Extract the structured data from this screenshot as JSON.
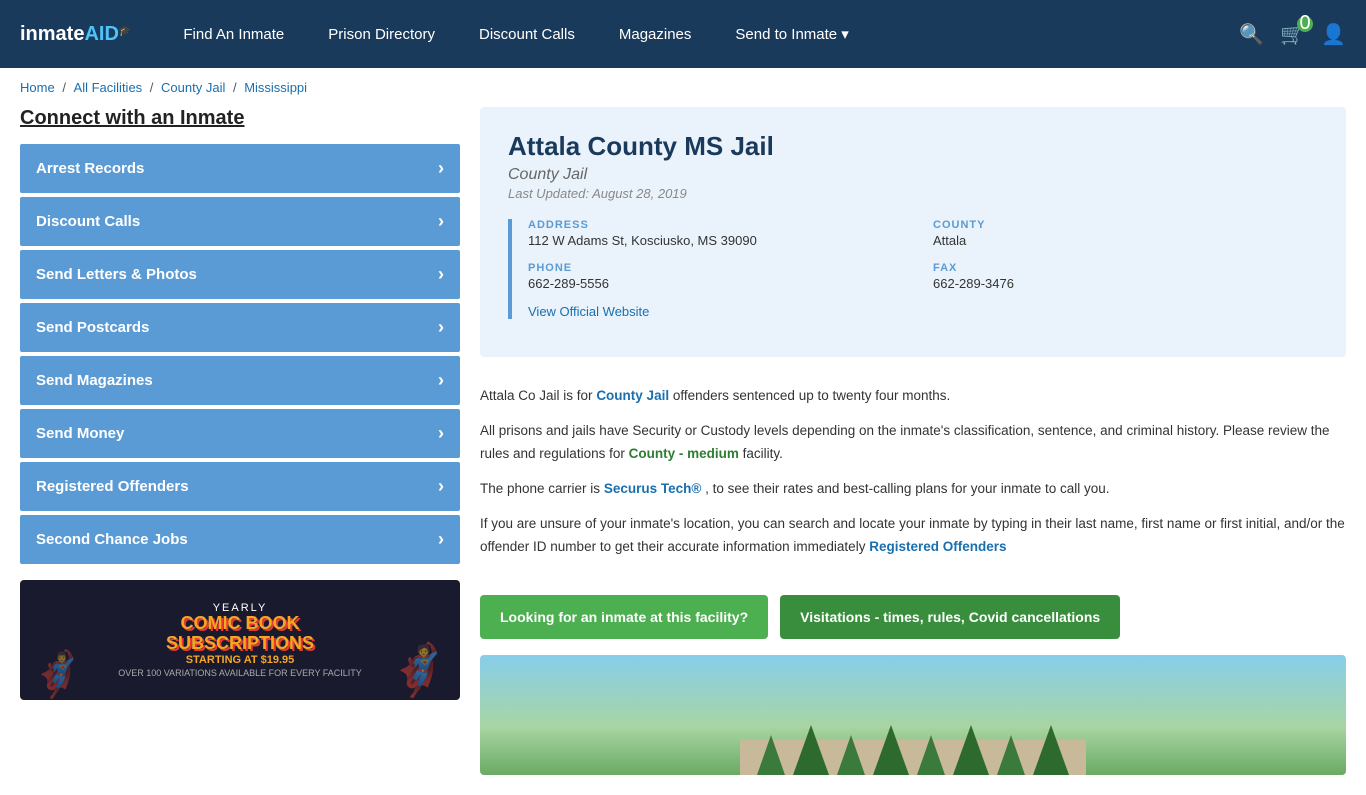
{
  "header": {
    "logo": "inmateAID",
    "logo_icon": "🎓",
    "nav": [
      {
        "label": "Find An Inmate",
        "href": "#"
      },
      {
        "label": "Prison Directory",
        "href": "#"
      },
      {
        "label": "Discount Calls",
        "href": "#"
      },
      {
        "label": "Magazines",
        "href": "#"
      },
      {
        "label": "Send to Inmate ▾",
        "href": "#"
      }
    ],
    "cart_count": "0",
    "search_placeholder": "Search..."
  },
  "breadcrumb": {
    "items": [
      "Home",
      "All Facilities",
      "County Jail",
      "Mississippi"
    ],
    "separators": [
      "/",
      "/",
      "/"
    ]
  },
  "sidebar": {
    "title": "Connect with an Inmate",
    "menu_items": [
      "Arrest Records",
      "Discount Calls",
      "Send Letters & Photos",
      "Send Postcards",
      "Send Magazines",
      "Send Money",
      "Registered Offenders",
      "Second Chance Jobs"
    ],
    "ad": {
      "eyebrow": "YEARLY",
      "title": "COMIC BOOK\nSUBSCRIPTIONS",
      "subtitle": "STARTING AT $19.95",
      "note": "OVER 100 VARIATIONS AVAILABLE FOR EVERY FACILITY"
    }
  },
  "facility": {
    "name": "Attala County MS Jail",
    "type": "County Jail",
    "last_updated": "Last Updated: August 28, 2019",
    "address_label": "ADDRESS",
    "address_value": "112 W Adams St, Kosciusko, MS 39090",
    "county_label": "COUNTY",
    "county_value": "Attala",
    "phone_label": "PHONE",
    "phone_value": "662-289-5556",
    "fax_label": "FAX",
    "fax_value": "662-289-3476",
    "website_label": "View Official Website",
    "website_href": "#",
    "desc1": "Attala Co Jail is for",
    "desc1_link": "County Jail",
    "desc1_end": " offenders sentenced up to twenty four months.",
    "desc2": "All prisons and jails have Security or Custody levels depending on the inmate's classification, sentence, and criminal history. Please review the rules and regulations for",
    "desc2_link": "County - medium",
    "desc2_end": " facility.",
    "desc3": "The phone carrier is",
    "desc3_link": "Securus Tech®",
    "desc3_end": ", to see their rates and best-calling plans for your inmate to call you.",
    "desc4": "If you are unsure of your inmate's location, you can search and locate your inmate by typing in their last name, first name or first initial, and/or the offender ID number to get their accurate information immediately",
    "desc4_link": "Registered Offenders",
    "btn1": "Looking for an inmate at this facility?",
    "btn2": "Visitations - times, rules, Covid cancellations"
  }
}
